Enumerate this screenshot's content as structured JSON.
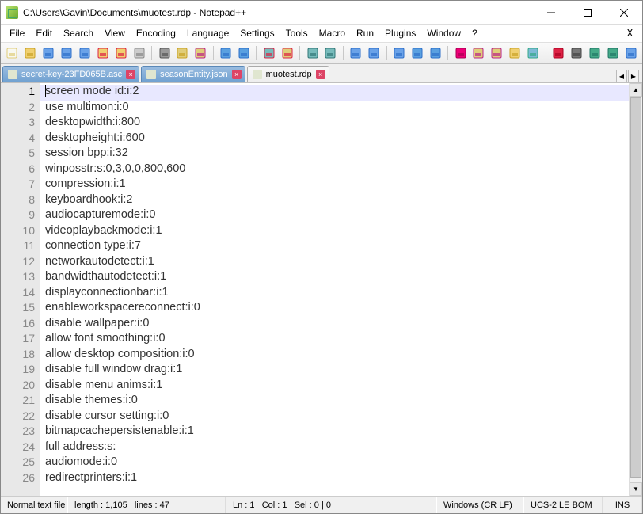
{
  "title": "C:\\Users\\Gavin\\Documents\\muotest.rdp - Notepad++",
  "menus": [
    "File",
    "Edit",
    "Search",
    "View",
    "Encoding",
    "Language",
    "Settings",
    "Tools",
    "Macro",
    "Run",
    "Plugins",
    "Window",
    "?"
  ],
  "toolbar_icons": [
    {
      "name": "new-file-icon",
      "fg": "#f8f8f0",
      "accent": "#e0cd7a"
    },
    {
      "name": "open-file-icon",
      "fg": "#f0d070",
      "accent": "#c9a227"
    },
    {
      "name": "save-icon",
      "fg": "#6aa2e8",
      "accent": "#2e6fc9"
    },
    {
      "name": "copy-save-icon",
      "fg": "#6aa2e8",
      "accent": "#2e6fc9"
    },
    {
      "name": "save-all-icon",
      "fg": "#6aa2e8",
      "accent": "#2e6fc9"
    },
    {
      "name": "close-file-icon",
      "fg": "#f0d070",
      "accent": "#d24"
    },
    {
      "name": "close-all-icon",
      "fg": "#f0d070",
      "accent": "#d24"
    },
    {
      "name": "print-icon",
      "fg": "#ccc",
      "accent": "#888"
    },
    {
      "sep": true
    },
    {
      "name": "cut-icon",
      "fg": "#999",
      "accent": "#555"
    },
    {
      "name": "copy-icon",
      "fg": "#e0cd7a",
      "accent": "#c9a227"
    },
    {
      "name": "paste-icon",
      "fg": "#e0cd7a",
      "accent": "#b28"
    },
    {
      "sep": true
    },
    {
      "name": "undo-icon",
      "fg": "#5aa0e0",
      "accent": "#2e6fc9"
    },
    {
      "name": "redo-icon",
      "fg": "#5aa0e0",
      "accent": "#2e6fc9"
    },
    {
      "sep": true
    },
    {
      "name": "find-icon",
      "fg": "#7bb",
      "accent": "#d24"
    },
    {
      "name": "replace-icon",
      "fg": "#e0cd7a",
      "accent": "#d24"
    },
    {
      "sep": true
    },
    {
      "name": "zoom-in-icon",
      "fg": "#7bb",
      "accent": "#377"
    },
    {
      "name": "zoom-out-icon",
      "fg": "#7bb",
      "accent": "#377"
    },
    {
      "sep": true
    },
    {
      "name": "sync-vscroll-icon",
      "fg": "#6aa2e8",
      "accent": "#2e6fc9"
    },
    {
      "name": "sync-hscroll-icon",
      "fg": "#6aa2e8",
      "accent": "#2e6fc9"
    },
    {
      "sep": true
    },
    {
      "name": "word-wrap-icon",
      "fg": "#6aa2e8",
      "accent": "#2e6fc9"
    },
    {
      "name": "all-chars-icon",
      "fg": "#5aa0e0",
      "accent": "#2e6fc9"
    },
    {
      "name": "indent-guide-icon",
      "fg": "#5aa0e0",
      "accent": "#2e6fc9"
    },
    {
      "sep": true
    },
    {
      "name": "lang-udl-icon",
      "fg": "#e07",
      "accent": "#a05"
    },
    {
      "name": "doc-map-icon",
      "fg": "#e0cd7a",
      "accent": "#b28"
    },
    {
      "name": "func-list-icon",
      "fg": "#e0cd7a",
      "accent": "#b28"
    },
    {
      "name": "folder-workspace-icon",
      "fg": "#f0d070",
      "accent": "#c9a227"
    },
    {
      "name": "monitoring-icon",
      "fg": "#7dbad6",
      "accent": "#3a8"
    },
    {
      "sep": true
    },
    {
      "name": "record-macro-icon",
      "fg": "#d24",
      "accent": "#a02"
    },
    {
      "name": "stop-macro-icon",
      "fg": "#777",
      "accent": "#444"
    },
    {
      "name": "play-macro-icon",
      "fg": "#4a8",
      "accent": "#276"
    },
    {
      "name": "play-multi-icon",
      "fg": "#4a8",
      "accent": "#276"
    },
    {
      "name": "save-macro-icon",
      "fg": "#6aa2e8",
      "accent": "#2e6fc9"
    }
  ],
  "tabs": [
    {
      "label": "secret-key-23FD065B.asc",
      "active": false
    },
    {
      "label": "seasonEntity.json",
      "active": false
    },
    {
      "label": "muotest.rdp",
      "active": true
    }
  ],
  "lines": [
    "screen mode id:i:2",
    "use multimon:i:0",
    "desktopwidth:i:800",
    "desktopheight:i:600",
    "session bpp:i:32",
    "winposstr:s:0,3,0,0,800,600",
    "compression:i:1",
    "keyboardhook:i:2",
    "audiocapturemode:i:0",
    "videoplaybackmode:i:1",
    "connection type:i:7",
    "networkautodetect:i:1",
    "bandwidthautodetect:i:1",
    "displayconnectionbar:i:1",
    "enableworkspacereconnect:i:0",
    "disable wallpaper:i:0",
    "allow font smoothing:i:0",
    "allow desktop composition:i:0",
    "disable full window drag:i:1",
    "disable menu anims:i:1",
    "disable themes:i:0",
    "disable cursor setting:i:0",
    "bitmapcachepersistenable:i:1",
    "full address:s:",
    "audiomode:i:0",
    "redirectprinters:i:1"
  ],
  "status": {
    "type": "Normal text file",
    "length_label": "length :",
    "length": "1,105",
    "lines_label": "lines :",
    "lines": "47",
    "ln_label": "Ln :",
    "ln": "1",
    "col_label": "Col :",
    "col": "1",
    "sel_label": "Sel :",
    "sel": "0 | 0",
    "eol": "Windows (CR LF)",
    "enc": "UCS-2 LE BOM",
    "mode": "INS"
  }
}
